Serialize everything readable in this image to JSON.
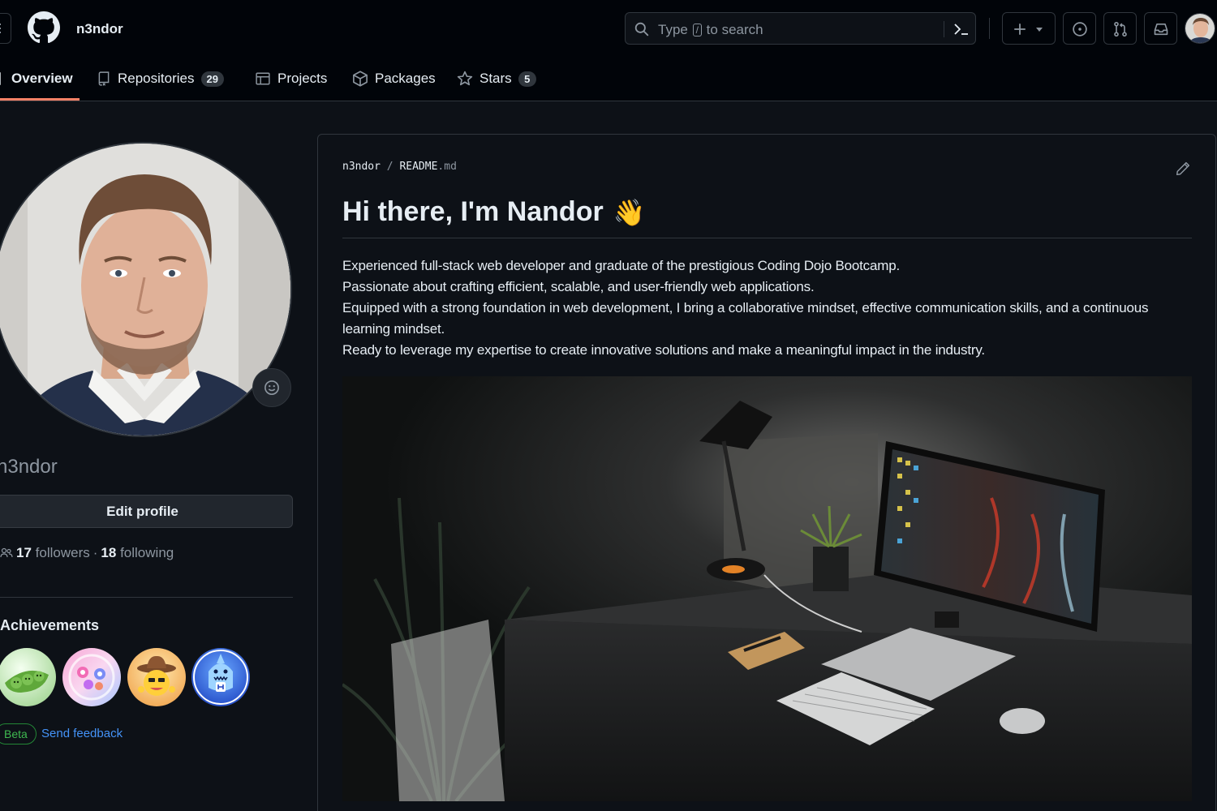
{
  "header": {
    "username": "n3ndor",
    "search": {
      "prefix": "Type",
      "key": "/",
      "suffix": "to search"
    }
  },
  "tabs": [
    {
      "label": "Overview",
      "count": null
    },
    {
      "label": "Repositories",
      "count": "29"
    },
    {
      "label": "Projects",
      "count": null
    },
    {
      "label": "Packages",
      "count": null
    },
    {
      "label": "Stars",
      "count": "5"
    }
  ],
  "profile": {
    "login": "n3ndor",
    "edit_label": "Edit profile",
    "followers_count": "17",
    "followers_label": "followers",
    "separator": "·",
    "following_count": "18",
    "following_label": "following",
    "achievements_title": "Achievements",
    "beta_label": "Beta",
    "feedback_label": "Send feedback"
  },
  "readme": {
    "owner": "n3ndor",
    "slash": "/",
    "filename": "README",
    "ext": ".md",
    "heading": "Hi there, I'm Nandor",
    "heading_emoji": "👋",
    "lines": [
      "Experienced full-stack web developer and graduate of the prestigious Coding Dojo Bootcamp.",
      "Passionate about crafting efficient, scalable, and user-friendly web applications.",
      "Equipped with a strong foundation in web development, I bring a collaborative mindset, effective communication skills, and a continuous learning mindset.",
      "Ready to leverage my expertise to create innovative solutions and make a meaningful impact in the industry."
    ]
  },
  "colors": {
    "background": "#0d1117",
    "header": "#010409",
    "border": "#30363d",
    "accent_tab": "#f78166",
    "link": "#4493f8",
    "beta": "#3fb950"
  }
}
